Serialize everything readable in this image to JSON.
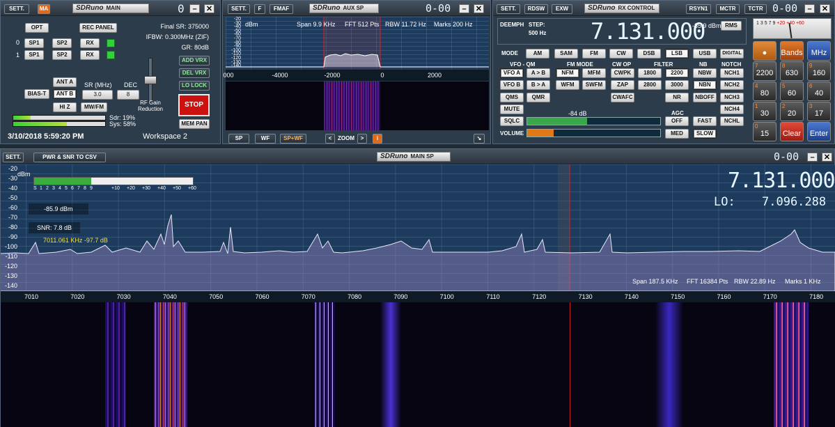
{
  "main": {
    "sett": "SETT.",
    "ma": "MA",
    "logo": "SDRuno",
    "title": "MAIN",
    "digit": "0",
    "opt": "OPT",
    "rec": "REC PANEL",
    "row0": "0",
    "row1": "1",
    "sp1": "SP1",
    "sp2": "SP2",
    "rx": "RX",
    "final_sr": "Final SR: 375000",
    "ifbw": "IFBW: 0.300MHz (ZIF)",
    "gr": "GR: 80dB",
    "add_vrx": "ADD VRX",
    "del_vrx": "DEL VRX",
    "lo_lock": "LO LOCK",
    "ant_a": "ANT A",
    "ant_b": "ANT B",
    "bias": "BIAS-T",
    "hiz": "HI Z",
    "mwfm": "MW/FM",
    "sr_label": "SR (MHz)",
    "sr_val": "3.0",
    "dec_label": "DEC",
    "dec_val": "8",
    "rf_gain": "RF Gain Reduction",
    "stop": "STOP",
    "mem": "MEM PAN",
    "sdr": "Sdr: 19%",
    "sys": "Sys: 58%",
    "cpu_sdr": 0.19,
    "cpu_sys": 0.58,
    "date": "3/10/2018 5:59:20 PM",
    "workspace": "Workspace 2"
  },
  "aux": {
    "sett": "SETT.",
    "f": "F",
    "fmaf": "FMAF",
    "logo": "SDRuno",
    "title": "AUX SP",
    "digit": "0-00",
    "dbm": "dBm",
    "span": "Span 9.9 KHz",
    "fft": "FFT 512 Pts",
    "rbw": "RBW 11.72 Hz",
    "marks": "Marks 200 Hz",
    "yticks": [
      "-20",
      "-30",
      "-40",
      "-50",
      "-60",
      "-70",
      "-80",
      "-90",
      "-100",
      "-110",
      "-120",
      "-130",
      "-140"
    ],
    "xticks": [
      "000",
      "-4000",
      "-2000",
      "0",
      "2000"
    ],
    "sp": "SP",
    "wf": "WF",
    "spwf": "SP+WF",
    "zoom": "ZOOM",
    "info": "i"
  },
  "rxc": {
    "sett": "SETT.",
    "rdsw": "RDSW",
    "exw": "EXW",
    "logo": "SDRuno",
    "title": "RX CONTROL",
    "rsyn": "RSYN1",
    "mctr": "MCTR",
    "tctr": "TCTR",
    "digit": "0-00",
    "deemph": "DEEMPH",
    "step": "STEP:",
    "step_val": "500 Hz",
    "freq": "7.131.000",
    "level": "-85.9 dBm",
    "rms": "RMS",
    "mode_label": "MODE",
    "modes": [
      "AM",
      "SAM",
      "FM",
      "CW",
      "DSB",
      "LSB",
      "USB",
      "DIGITAL"
    ],
    "vfoqm": "VFO - QM",
    "fmmode": "FM MODE",
    "cwop": "CW OP",
    "filter": "FILTER",
    "nb": "NB",
    "notch": "NOTCH",
    "vfoa": "VFO A",
    "ab": "A > B",
    "nfm": "NFM",
    "mfm": "MFM",
    "cwpk": "CWPK",
    "f1800": "1800",
    "f2200": "2200",
    "nbw": "NBW",
    "nch1": "NCH1",
    "vfob": "VFO B",
    "ba": "B > A",
    "wfm": "WFM",
    "swfm": "SWFM",
    "zap": "ZAP",
    "f2800": "2800",
    "f3000": "3000",
    "nbn": "NBN",
    "nch2": "NCH2",
    "qms": "QMS",
    "qmr": "QMR",
    "cwafc": "CWAFC",
    "nr": "NR",
    "nboff": "NBOFF",
    "nch3": "NCH3",
    "mute": "MUTE",
    "agc": "AGC",
    "nch4": "NCH4",
    "sqlc": "SQLC",
    "off": "OFF",
    "fast": "FAST",
    "nchl": "NCHL",
    "db84": "-84 dB",
    "volume": "VOLUME",
    "med": "MED",
    "slow": "SLOW",
    "sq_level": 0.45,
    "vol_level": 0.2
  },
  "keypad": {
    "keys": [
      {
        "n": "",
        "l": "●"
      },
      {
        "n": "",
        "l": "Bands"
      },
      {
        "n": "",
        "l": "MHz"
      },
      {
        "n": "7",
        "l": "2200"
      },
      {
        "n": "8",
        "l": "630"
      },
      {
        "n": "9",
        "l": "160"
      },
      {
        "n": "4",
        "l": "80"
      },
      {
        "n": "5",
        "l": "60"
      },
      {
        "n": "6",
        "l": "40"
      },
      {
        "n": "1",
        "l": "30"
      },
      {
        "n": "2",
        "l": "20"
      },
      {
        "n": "3",
        "l": "17"
      },
      {
        "n": "0",
        "l": "15"
      },
      {
        "n": "",
        "l": "Clear"
      },
      {
        "n": "",
        "l": "Enter"
      }
    ],
    "meter": [
      "1",
      "3",
      "5",
      "7",
      "9",
      "+20",
      "+40",
      "+60"
    ]
  },
  "mainsp": {
    "sett": "SETT.",
    "pwr": "PWR & SNR TO CSV",
    "logo": "SDRuno",
    "title": "MAIN SP",
    "digit": "0-00",
    "dbm": "dBm",
    "smeter": [
      "S",
      "1",
      "2",
      "3",
      "4",
      "5",
      "6",
      "7",
      "8",
      "9",
      "+10",
      "+20",
      "+30",
      "+40",
      "+50",
      "+60"
    ],
    "level": "-85.9 dBm",
    "snr": "SNR: 7.8 dB",
    "peak": "7011.061 KHz -97.7 dB",
    "big_freq": "7.131.000",
    "lo_label": "LO:",
    "lo_freq": "7.096.288",
    "span": "Span 187.5 KHz",
    "fft": "FFT 16384 Pts",
    "rbw": "RBW 22.89 Hz",
    "marks": "Marks 1 KHz",
    "yticks": [
      "-20",
      "-30",
      "-40",
      "-50",
      "-60",
      "-70",
      "-80",
      "-90",
      "-100",
      "-110",
      "-120",
      "-130",
      "-140"
    ],
    "xticks": [
      "7010",
      "7020",
      "7030",
      "7040",
      "7050",
      "7060",
      "7070",
      "7080",
      "7090",
      "7100",
      "7110",
      "7120",
      "7130",
      "7140",
      "7150",
      "7160",
      "7170",
      "7180",
      "71"
    ]
  }
}
